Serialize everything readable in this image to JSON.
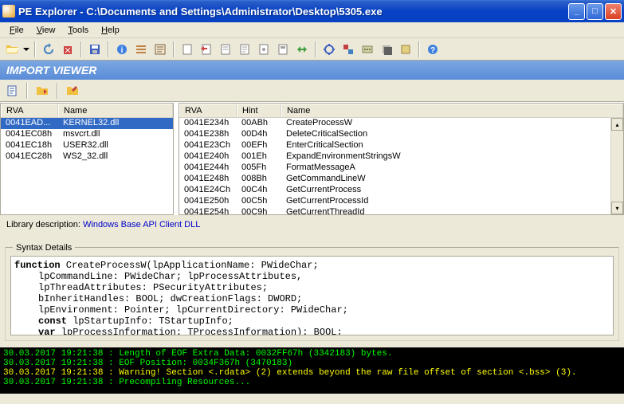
{
  "window": {
    "title": "PE Explorer - C:\\Documents and Settings\\Administrator\\Desktop\\5305.exe"
  },
  "menu": {
    "file": "File",
    "view": "View",
    "tools": "Tools",
    "help": "Help"
  },
  "section_header": "IMPORT VIEWER",
  "left_cols": {
    "rva": "RVA",
    "name": "Name"
  },
  "left_rows": [
    {
      "rva": "0041EAD...",
      "name": "KERNEL32.dll",
      "sel": true
    },
    {
      "rva": "0041EC08h",
      "name": "msvcrt.dll"
    },
    {
      "rva": "0041EC18h",
      "name": "USER32.dll"
    },
    {
      "rva": "0041EC28h",
      "name": "WS2_32.dll"
    }
  ],
  "right_cols": {
    "rva": "RVA",
    "hint": "Hint",
    "name": "Name"
  },
  "right_rows": [
    {
      "rva": "0041E234h",
      "hint": "00ABh",
      "name": "CreateProcessW"
    },
    {
      "rva": "0041E238h",
      "hint": "00D4h",
      "name": "DeleteCriticalSection"
    },
    {
      "rva": "0041E23Ch",
      "hint": "00EFh",
      "name": "EnterCriticalSection"
    },
    {
      "rva": "0041E240h",
      "hint": "001Eh",
      "name": "ExpandEnvironmentStringsW"
    },
    {
      "rva": "0041E244h",
      "hint": "005Fh",
      "name": "FormatMessageA"
    },
    {
      "rva": "0041E248h",
      "hint": "008Bh",
      "name": "GetCommandLineW"
    },
    {
      "rva": "0041E24Ch",
      "hint": "00C4h",
      "name": "GetCurrentProcess"
    },
    {
      "rva": "0041E250h",
      "hint": "00C5h",
      "name": "GetCurrentProcessId"
    },
    {
      "rva": "0041E254h",
      "hint": "00C9h",
      "name": "GetCurrentThreadId"
    }
  ],
  "lib_desc": {
    "label": "Library description:",
    "value": "Windows Base API Client DLL"
  },
  "syntax": {
    "label": "Syntax Details",
    "l1a": "function",
    "l1b": " CreateProcessW(lpApplicationName: PWideChar;",
    "l2": "lpCommandLine: PWideChar; lpProcessAttributes,",
    "l3": "lpThreadAttributes: PSecurityAttributes;",
    "l4": "bInheritHandles: BOOL; dwCreationFlags: DWORD;",
    "l5": "lpEnvironment: Pointer; lpCurrentDirectory: PWideChar;",
    "l6a": "const",
    "l6b": " lpStartupInfo: TStartupInfo;",
    "l7a": "var",
    "l7b": " lpProcessInformation: TProcessInformation): BOOL;"
  },
  "console": {
    "l1": "30.03.2017 19:21:38 : Length of EOF Extra Data: 0032FF67h  (3342183) bytes.",
    "l2": "30.03.2017 19:21:38 : EOF Position: 0034F367h  (3470183)",
    "l3": "30.03.2017 19:21:38 : Warning! Section <.rdata> (2) extends beyond the raw file offset of section <.bss> (3).",
    "l4": "30.03.2017 19:21:38 : Precompiling Resources..."
  }
}
